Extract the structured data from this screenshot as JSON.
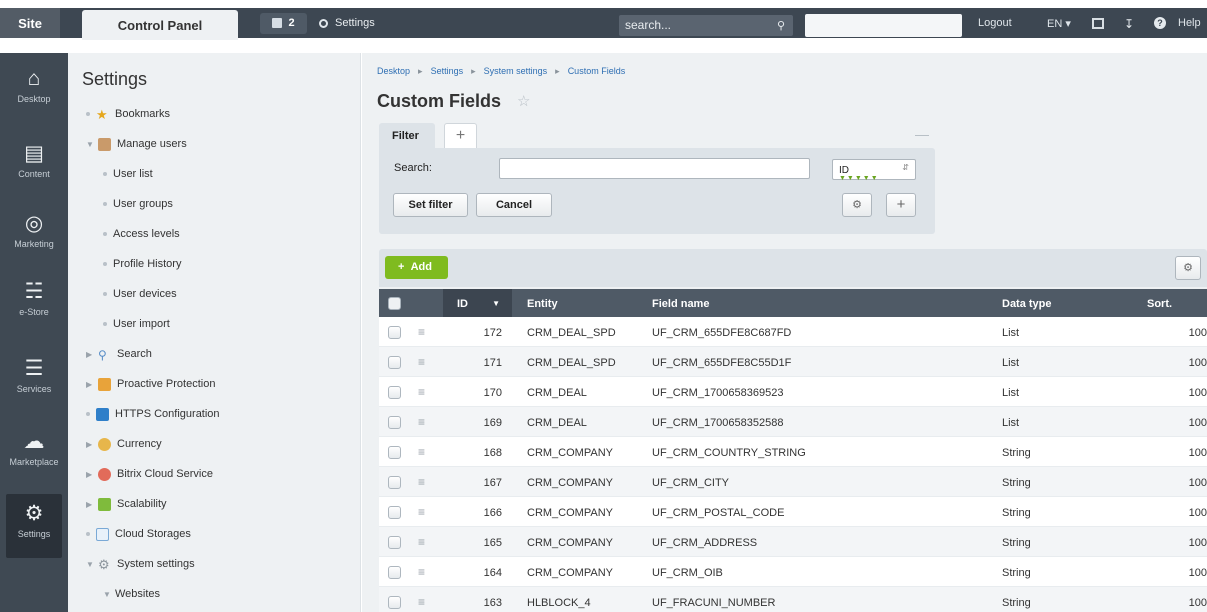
{
  "topbar": {
    "site": "Site",
    "control_panel": "Control Panel",
    "notifications_count": "2",
    "settings": "Settings",
    "search_placeholder": "search...",
    "logout": "Logout",
    "language": "EN",
    "help": "Help"
  },
  "rail": {
    "items": [
      {
        "label": "Desktop",
        "icon": "home-icon"
      },
      {
        "label": "Content",
        "icon": "document-icon"
      },
      {
        "label": "Marketing",
        "icon": "target-icon"
      },
      {
        "label": "e-Store",
        "icon": "basket-icon"
      },
      {
        "label": "Services",
        "icon": "layers-icon"
      },
      {
        "label": "Marketplace",
        "icon": "cloud-download-icon"
      },
      {
        "label": "Settings",
        "icon": "gear-icon"
      }
    ]
  },
  "tree": {
    "title": "Settings",
    "items": [
      {
        "label": "Bookmarks"
      },
      {
        "label": "Manage users"
      },
      {
        "label": "User list"
      },
      {
        "label": "User groups"
      },
      {
        "label": "Access levels"
      },
      {
        "label": "Profile History"
      },
      {
        "label": "User devices"
      },
      {
        "label": "User import"
      },
      {
        "label": "Search"
      },
      {
        "label": "Proactive Protection"
      },
      {
        "label": "HTTPS Configuration"
      },
      {
        "label": "Currency"
      },
      {
        "label": "Bitrix Cloud Service"
      },
      {
        "label": "Scalability"
      },
      {
        "label": "Cloud Storages"
      },
      {
        "label": "System settings"
      },
      {
        "label": "Websites"
      }
    ]
  },
  "breadcrumb": [
    "Desktop",
    "Settings",
    "System settings",
    "Custom Fields"
  ],
  "page_title": "Custom Fields",
  "filter": {
    "tab_label": "Filter",
    "search_label": "Search:",
    "search_value": "",
    "select_value": "ID",
    "set_filter": "Set filter",
    "cancel": "Cancel"
  },
  "list": {
    "add_label": "Add",
    "columns": {
      "id": "ID",
      "entity": "Entity",
      "field_name": "Field name",
      "data_type": "Data type",
      "sort": "Sort."
    },
    "rows": [
      {
        "id": "172",
        "entity": "CRM_DEAL_SPD",
        "field_name": "UF_CRM_655DFE8C687FD",
        "data_type": "List",
        "sort": "100"
      },
      {
        "id": "171",
        "entity": "CRM_DEAL_SPD",
        "field_name": "UF_CRM_655DFE8C55D1F",
        "data_type": "List",
        "sort": "100"
      },
      {
        "id": "170",
        "entity": "CRM_DEAL",
        "field_name": "UF_CRM_1700658369523",
        "data_type": "List",
        "sort": "100"
      },
      {
        "id": "169",
        "entity": "CRM_DEAL",
        "field_name": "UF_CRM_1700658352588",
        "data_type": "List",
        "sort": "100"
      },
      {
        "id": "168",
        "entity": "CRM_COMPANY",
        "field_name": "UF_CRM_COUNTRY_STRING",
        "data_type": "String",
        "sort": "100"
      },
      {
        "id": "167",
        "entity": "CRM_COMPANY",
        "field_name": "UF_CRM_CITY",
        "data_type": "String",
        "sort": "100"
      },
      {
        "id": "166",
        "entity": "CRM_COMPANY",
        "field_name": "UF_CRM_POSTAL_CODE",
        "data_type": "String",
        "sort": "100"
      },
      {
        "id": "165",
        "entity": "CRM_COMPANY",
        "field_name": "UF_CRM_ADDRESS",
        "data_type": "String",
        "sort": "100"
      },
      {
        "id": "164",
        "entity": "CRM_COMPANY",
        "field_name": "UF_CRM_OIB",
        "data_type": "String",
        "sort": "100"
      },
      {
        "id": "163",
        "entity": "HLBLOCK_4",
        "field_name": "UF_FRACUNI_NUMBER",
        "data_type": "String",
        "sort": "100"
      }
    ]
  }
}
